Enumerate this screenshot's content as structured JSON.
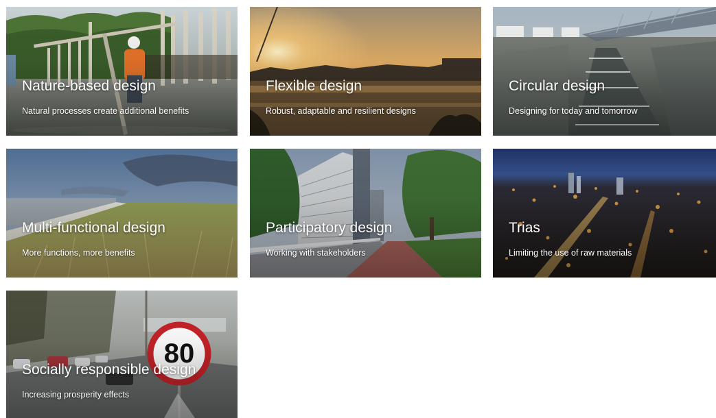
{
  "cards": [
    {
      "title": "Nature-based design",
      "subtitle": "Natural processes create additional benefits"
    },
    {
      "title": "Flexible design",
      "subtitle": "Robust, adaptable and resilient designs"
    },
    {
      "title": "Circular design",
      "subtitle": "Designing for today and tomorrow"
    },
    {
      "title": "Multi-functional design",
      "subtitle": "More functions, more benefits"
    },
    {
      "title": "Participatory design",
      "subtitle": "Working with stakeholders"
    },
    {
      "title": "Trias",
      "subtitle": "Limiting the use of raw materials"
    },
    {
      "title": "Socially responsible design",
      "subtitle": "Increasing prosperity effects"
    }
  ],
  "sign_text": "80"
}
